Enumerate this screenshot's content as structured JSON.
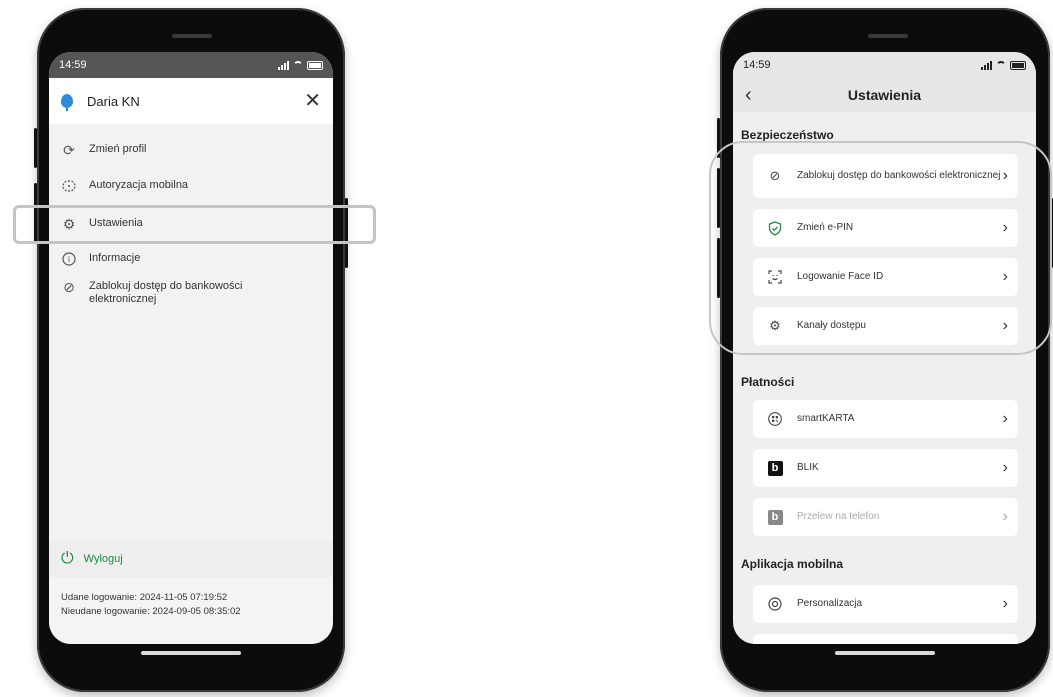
{
  "left_phone": {
    "status": {
      "time": "14:59"
    },
    "profile": {
      "name": "Daria KN",
      "close_icon": "close-icon",
      "avatar_icon": "balloon-icon"
    },
    "menu": [
      {
        "label": "Zmień profil",
        "icon": "refresh-icon"
      },
      {
        "label": "Autoryzacja mobilna",
        "icon": "mobile-auth-icon"
      },
      {
        "label": "Ustawienia",
        "icon": "gear-icon"
      },
      {
        "label": "Informacje",
        "icon": "info-icon"
      },
      {
        "label": "Zablokuj dostęp do bankowości elektronicznej",
        "icon": "block-icon"
      }
    ],
    "logout": {
      "label": "Wyloguj",
      "icon": "power-icon",
      "color": "#1a8a3e"
    },
    "login_info": {
      "success": "Udane logowanie: 2024-11-05 07:19:52",
      "failed": "Nieudane logowanie: 2024-09-05 08:35:02"
    }
  },
  "right_phone": {
    "status": {
      "time": "14:59"
    },
    "nav": {
      "title": "Ustawienia",
      "back_icon": "chevron-left-icon"
    },
    "sections": {
      "security": {
        "title": "Bezpieczeństwo",
        "items": [
          {
            "label": "Zablokuj dostęp do bankowości elektronicznej",
            "icon": "block-icon"
          },
          {
            "label": "Zmień e-PIN",
            "icon": "shield-check-icon"
          },
          {
            "label": "Logowanie Face ID",
            "icon": "face-id-icon"
          },
          {
            "label": "Kanały dostępu",
            "icon": "gear-icon"
          }
        ]
      },
      "payments": {
        "title": "Płatności",
        "items": [
          {
            "label": "smartKARTA",
            "icon": "qr-icon"
          },
          {
            "label": "BLIK",
            "icon": "blik-icon"
          },
          {
            "label": "Przelew na telefon",
            "icon": "blik-icon",
            "disabled": true
          }
        ]
      },
      "mobile_app": {
        "title": "Aplikacja mobilna",
        "items": [
          {
            "label": "Personalizacja",
            "icon": "personalize-icon"
          }
        ]
      }
    }
  },
  "chevron": "›",
  "blik_letter": "b",
  "highlight_color": "#c4c4c4"
}
